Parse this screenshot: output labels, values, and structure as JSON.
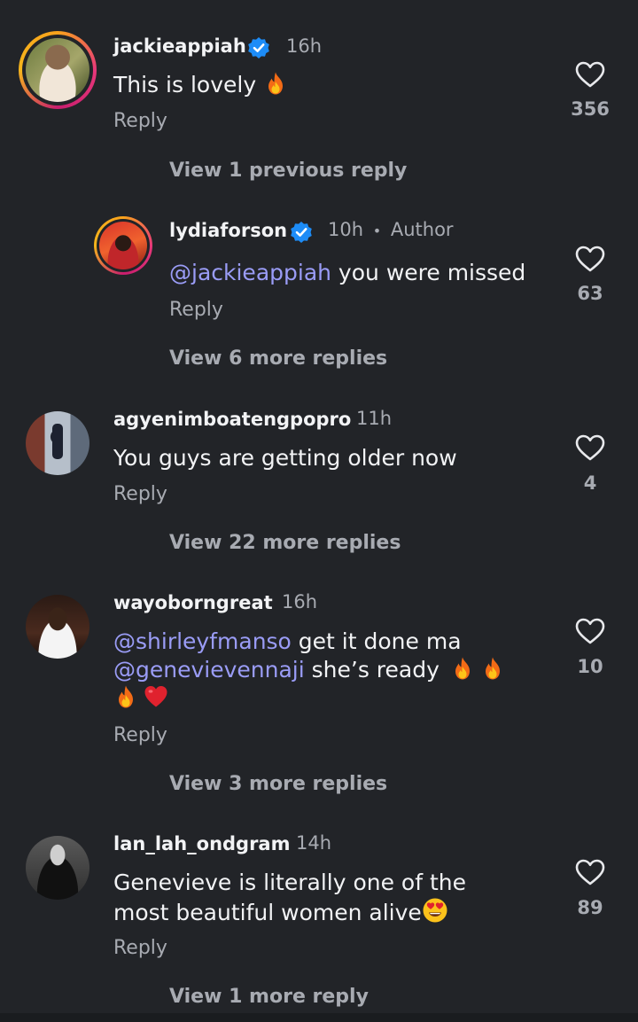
{
  "comments": [
    {
      "username": "jackieappiah",
      "time": "16h",
      "text": "This is lovely",
      "likes": "356",
      "reply": "Reply",
      "view_link": "View 1 previous reply",
      "verified": true
    },
    {
      "username": "lydiaforson",
      "time": "10h",
      "author_sep": "•",
      "author_label": "Author",
      "mention": "@jackieappiah",
      "text": " you were missed",
      "likes": "63",
      "reply": "Reply",
      "view_link": "View 6 more replies",
      "verified": true
    },
    {
      "username": "agyenimboatengpopro",
      "time": "11h",
      "text": "You guys are getting older now",
      "likes": "4",
      "reply": "Reply",
      "view_link": "View 22 more replies"
    },
    {
      "username": "wayoborngreat",
      "time": "16h",
      "mention1": "@shirleyfmanso",
      "text1": " get it done ma",
      "mention2": "@genevievennaji",
      "text2": " she’s ready",
      "likes": "10",
      "reply": "Reply",
      "view_link": "View 3 more replies"
    },
    {
      "username": "lan_lah_ondgram",
      "time": "14h",
      "text_line1": "Genevieve is literally one of the",
      "text_line2": "most beautiful women alive",
      "likes": "89",
      "reply": "Reply",
      "view_link": "View 1 more reply"
    }
  ],
  "icons": {
    "heart": "heart-outline-icon",
    "verified": "verified-badge-icon",
    "fire": "fire-emoji",
    "red_heart": "red-heart-emoji",
    "heart_eyes": "heart-eyes-emoji"
  },
  "colors": {
    "background": "#222428",
    "text": "#f2f3f5",
    "muted": "#a8abb2",
    "mention": "#9a9cf6",
    "verified": "#1d8cf7"
  }
}
